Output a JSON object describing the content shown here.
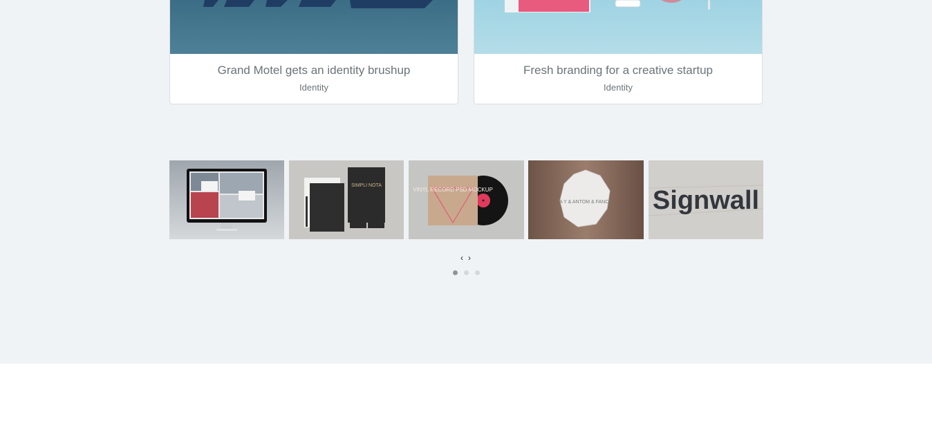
{
  "cards": [
    {
      "title": "Grand Motel gets an identity brushup",
      "tag": "Identity"
    },
    {
      "title": "Fresh branding for a creative startup",
      "tag": "Identity"
    }
  ],
  "carousel": {
    "items": [
      {
        "label": ""
      },
      {
        "label": "SIMPLI NOTA"
      },
      {
        "label": "VINYL RECORD PSD MOCKUP"
      },
      {
        "label": "A Y & ANTOM & FANCY"
      },
      {
        "label": "Signwall"
      }
    ],
    "prev_glyph": "‹",
    "next_glyph": "›",
    "dots": 3,
    "active_dot": 0
  },
  "colors": {
    "section_bg": "#f0f3f6",
    "card_text": "#6b7378",
    "dot_active": "#8d9599",
    "dot_inactive": "#d3d8dc"
  }
}
